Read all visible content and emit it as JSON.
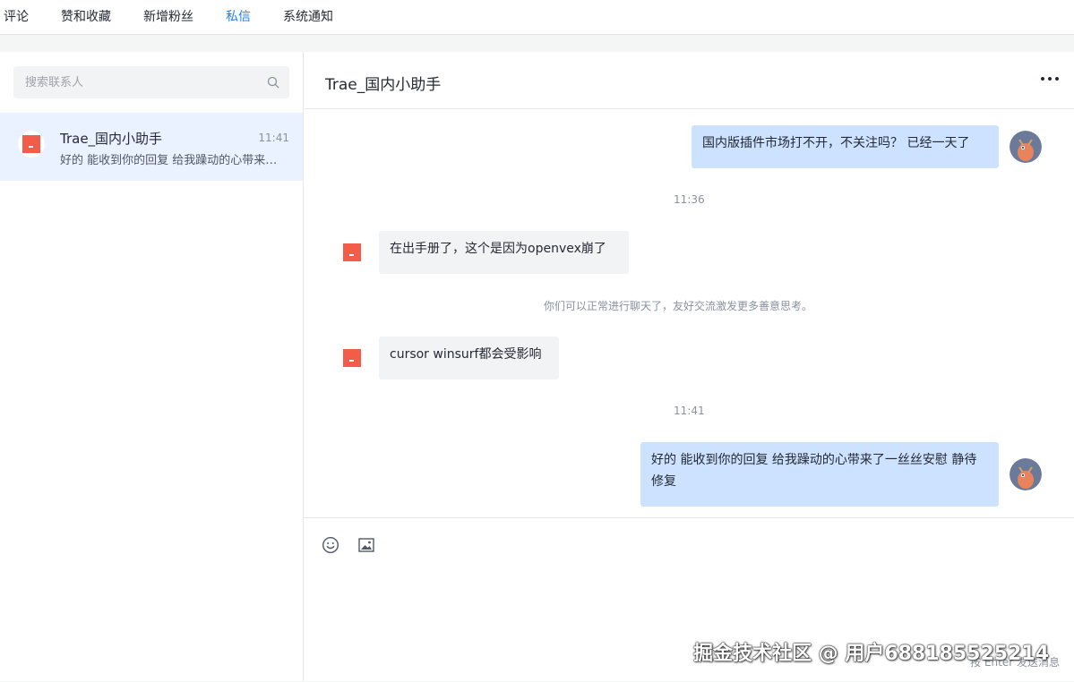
{
  "nav": {
    "tabs": [
      {
        "label": "评论"
      },
      {
        "label": "赞和收藏"
      },
      {
        "label": "新增粉丝"
      },
      {
        "label": "私信"
      },
      {
        "label": "系统通知"
      }
    ],
    "active": "私信",
    "active_color": "#1e80ff"
  },
  "sidebar": {
    "search_placeholder": "搜索联系人",
    "contact": {
      "name": "Trae_国内小助手",
      "time": "11:41",
      "preview": "好的 能收到你的回复 给我躁动的心带来了一丝丝安慰 静待修复"
    }
  },
  "chat": {
    "title": "Trae_国内小助手",
    "messages": [
      {
        "from": "me",
        "text": "国内版插件市场打不开，不关注吗？ 已经一天了"
      },
      {
        "time": "11:36"
      },
      {
        "from": "bot",
        "text": "在出手册了，这个是因为openvex崩了"
      },
      {
        "system": "你们可以正常进行聊天了，友好交流激发更多善意思考。"
      },
      {
        "from": "bot",
        "text": "cursor winsurf都会受影响"
      },
      {
        "time": "11:41"
      },
      {
        "from": "me",
        "text": "好的 能收到你的回复 给我躁动的心带来了一丝丝安慰 静待修复"
      }
    ]
  },
  "composer": {
    "hint": "按 Enter 发送消息"
  },
  "watermark": "掘金技术社区 @ 用户688185525214",
  "colors": {
    "my_bubble": "#cce2ff",
    "bot_bubble": "#f2f3f5",
    "bot_logo": "#f25c48",
    "accent": "#1e80ff"
  }
}
